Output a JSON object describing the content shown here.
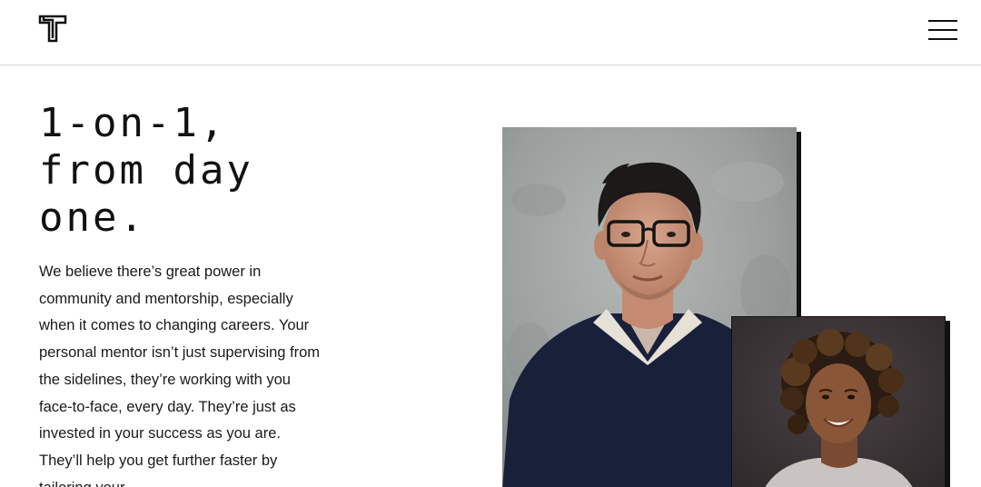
{
  "header": {
    "logo_icon": "t-logo-icon",
    "menu_icon": "hamburger-menu-icon"
  },
  "hero": {
    "title_lines": [
      "1-on-1,",
      "from day",
      "one."
    ],
    "body": "We believe there’s great power in community and mentorship, especially when it comes to changing careers. Your personal mentor isn’t just supervising from the sidelines, they’re working with you face-to-face, every day. They’re just as invested in your success as you are. They’ll help you get further faster by tailoring your"
  },
  "images": {
    "mentor_photo": "mentor-portrait",
    "student_photo": "student-portrait"
  },
  "colors": {
    "text": "#111111",
    "background": "#ffffff",
    "divider": "#d9d9d9",
    "shadow": "#111111"
  }
}
